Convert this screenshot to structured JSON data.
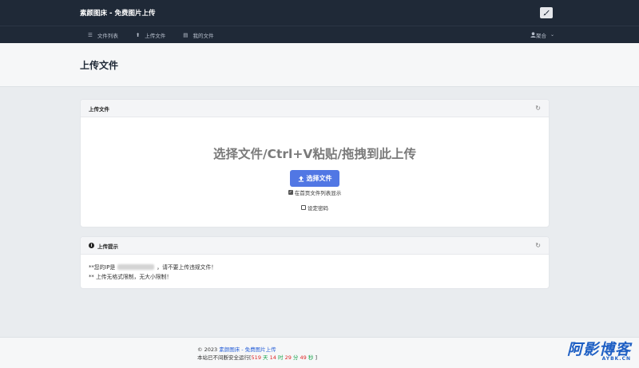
{
  "header": {
    "brand": "素颜图床 - 免费图片上传",
    "nav": [
      {
        "icon": "list-icon",
        "glyph": "☰",
        "label": "文件列表"
      },
      {
        "icon": "upload-icon",
        "glyph": "⬆",
        "label": "上传文件"
      },
      {
        "icon": "file-icon",
        "glyph": "▤",
        "label": "我的文件"
      }
    ],
    "user_menu": "聚合"
  },
  "page": {
    "title": "上传文件"
  },
  "upload_card": {
    "title": "上传文件",
    "drop_text": "选择文件/Ctrl+V粘贴/拖拽到此上传",
    "choose_button": "选择文件",
    "options": [
      {
        "label": "在首页文件列表显示",
        "checked": true
      },
      {
        "label": "设定密码",
        "checked": false
      }
    ]
  },
  "tips_card": {
    "title": "上传提示",
    "ip_prefix": "**您的IP是",
    "ip_suffix": "，请不要上传违规文件！",
    "line2": "** 上传无格式限制，无大小限制！"
  },
  "footer": {
    "copyright": "© 2023",
    "site_link": "素颜图床 - 免费图片上传",
    "uptime_prefix": "本站已不间断安全运行[",
    "days": "519",
    "days_unit": "天",
    "hours": "14",
    "hours_unit": "时",
    "minutes": "29",
    "minutes_unit": "分",
    "seconds": "49",
    "seconds_unit": "秒",
    "uptime_suffix": "]"
  },
  "watermark": {
    "main": "阿影博客",
    "sub": "AYBK.CN"
  },
  "colors": {
    "topbar": "#1f2937",
    "primary": "#5177e4",
    "link": "#2b62d8"
  }
}
